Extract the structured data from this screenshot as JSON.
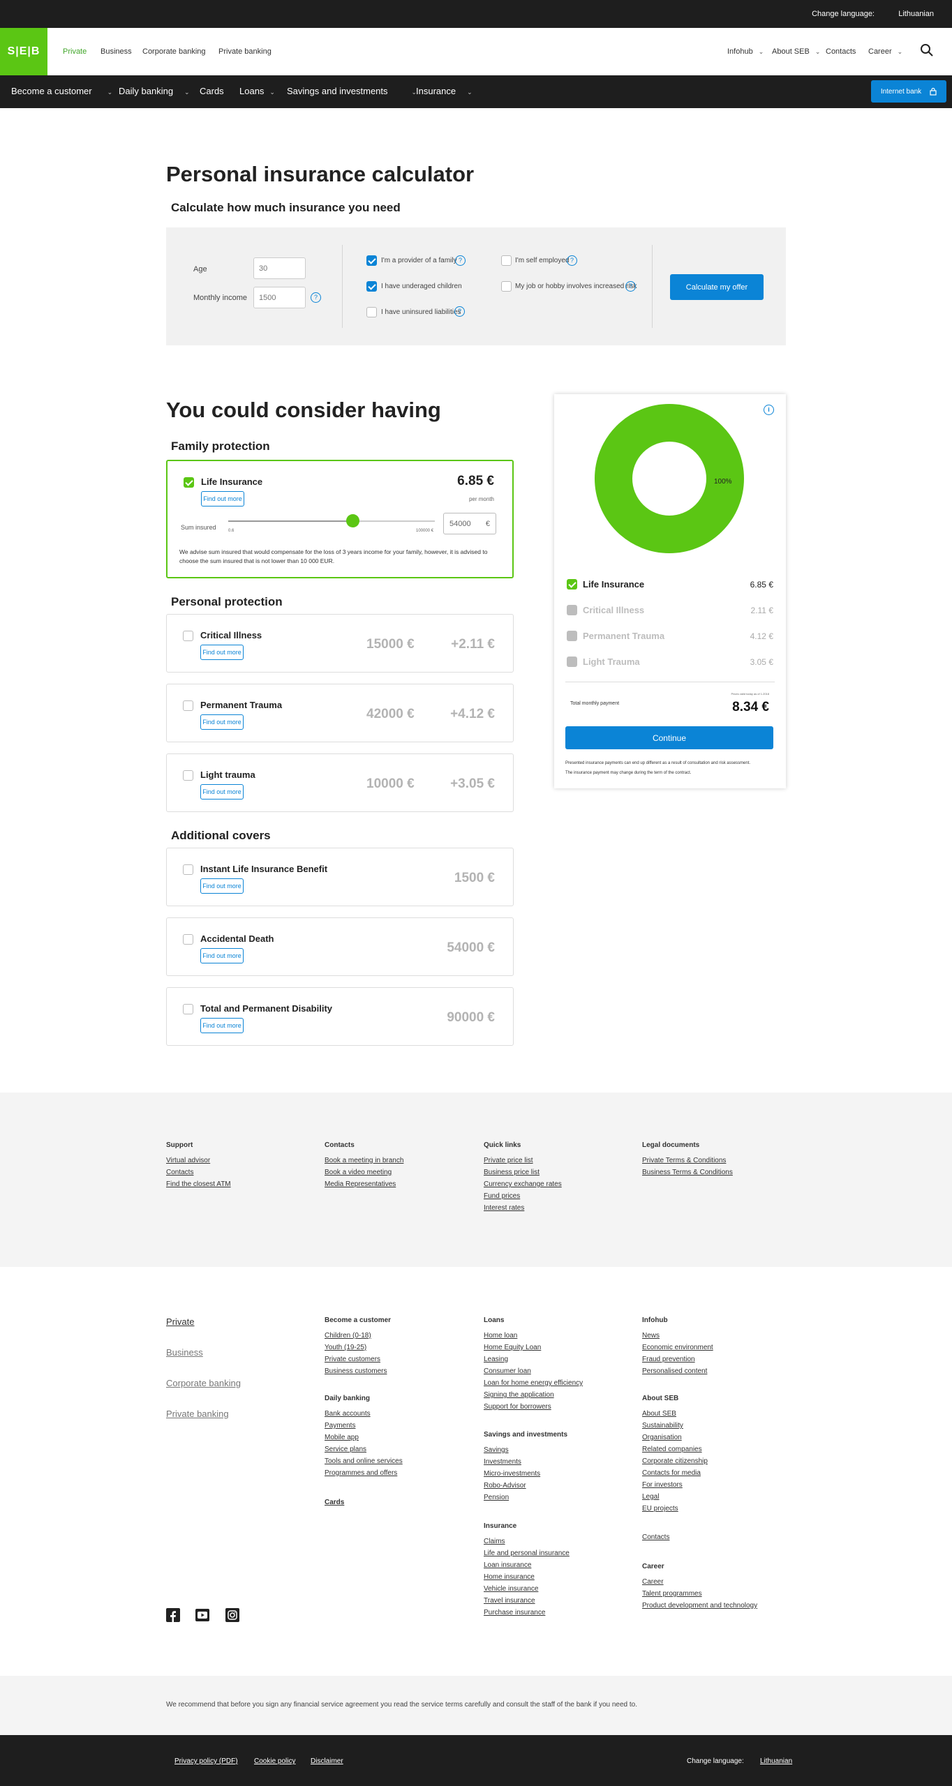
{
  "topbar": {
    "change_language_label": "Change language:",
    "language_link": "Lithuanian"
  },
  "header": {
    "logo": "S|E|B",
    "segments": [
      "Private",
      "Business",
      "Corporate banking",
      "Private banking"
    ],
    "right_nav": [
      "Infohub",
      "About SEB",
      "Contacts",
      "Career"
    ]
  },
  "main_nav": {
    "items": [
      "Become a customer",
      "Daily banking",
      "Cards",
      "Loans",
      "Savings and investments",
      "Insurance"
    ],
    "internet_bank": "Internet bank"
  },
  "calculator": {
    "title": "Personal insurance calculator",
    "subtitle": "Calculate how much insurance you need",
    "age_label": "Age",
    "age_value": "30",
    "income_label": "Monthly income",
    "income_value": "1500",
    "options": [
      {
        "label": "I'm a provider of a family",
        "checked": true
      },
      {
        "label": "I have underaged children",
        "checked": true
      },
      {
        "label": "I have uninsured liabilities",
        "checked": false
      },
      {
        "label": "I'm self employed",
        "checked": false
      },
      {
        "label": "My job or hobby involves increased risk",
        "checked": false
      }
    ],
    "button": "Calculate my offer"
  },
  "results": {
    "title": "You could consider having",
    "find_out_more": "Find out more",
    "family_protection": {
      "heading": "Family protection",
      "life_insurance": {
        "name": "Life Insurance",
        "price": "6.85 €",
        "per": "per month",
        "sum_label": "Sum insured",
        "slider_min": "0.6",
        "slider_max": "100000 €",
        "slider_level": 0.6,
        "sum_value": "54000",
        "currency": "€",
        "advice": "We advise sum insured that would compensate for the loss of 3 years income for your family, however, it is advised to choose the sum insured that is not lower than 10 000 EUR."
      }
    },
    "personal_protection": {
      "heading": "Personal protection",
      "items": [
        {
          "name": "Critical Illness",
          "amount": "15000 €",
          "price": "+2.11 €"
        },
        {
          "name": "Permanent Trauma",
          "amount": "42000 €",
          "price": "+4.12 €"
        },
        {
          "name": "Light trauma",
          "amount": "10000 €",
          "price": "+3.05 €"
        }
      ]
    },
    "additional_covers": {
      "heading": "Additional covers",
      "items": [
        {
          "name": "Instant Life Insurance Benefit",
          "amount": "1500 €"
        },
        {
          "name": "Accidental Death",
          "amount": "54000 €"
        },
        {
          "name": "Total and Permanent Disability",
          "amount": "90000 €"
        }
      ]
    }
  },
  "summary": {
    "donut_percent": "100%",
    "donut_color": "#5bc614",
    "rows": [
      {
        "name": "Life Insurance",
        "value": "6.85 €",
        "checked": true
      },
      {
        "name": "Critical Illness",
        "value": "2.11 €",
        "checked": false
      },
      {
        "name": "Permanent Trauma",
        "value": "4.12 €",
        "checked": false
      },
      {
        "name": "Light Trauma",
        "value": "3.05 €",
        "checked": false
      }
    ],
    "fine_print": "Prices valid today as of 1.2018",
    "total_label": "Total monthly payment",
    "total_value": "8.34 €",
    "continue": "Continue",
    "note1": "Presented insurance payments can end up different as a result of consultation and risk assessment.",
    "note2": "The insurance payment may change during the term of the contract."
  },
  "footer_top": {
    "columns": [
      {
        "heading": "Support",
        "links": [
          "Virtual advisor",
          "Contacts",
          "Find the closest ATM"
        ]
      },
      {
        "heading": "Contacts",
        "links": [
          "Book a meeting in branch",
          "Book a video meeting",
          "Media Representatives"
        ]
      },
      {
        "heading": "Quick links",
        "links": [
          "Private price list",
          "Business price list",
          "Currency exchange rates",
          "Fund prices",
          "Interest rates"
        ]
      },
      {
        "heading": "Legal documents",
        "links": [
          "Private Terms & Conditions",
          "Business Terms & Conditions"
        ]
      }
    ]
  },
  "footer_main": {
    "segments": [
      "Private",
      "Business",
      "Corporate banking",
      "Private banking"
    ],
    "become_customer": {
      "heading": "Become a customer",
      "links": [
        "Children (0-18)",
        "Youth (19-25)",
        "Private customers",
        "Business customers"
      ]
    },
    "daily_banking": {
      "heading": "Daily banking",
      "links": [
        "Bank accounts",
        "Payments",
        "Mobile app",
        "Service plans",
        "Tools and online services",
        "Programmes and offers"
      ]
    },
    "cards": {
      "heading": "Cards"
    },
    "loans": {
      "heading": "Loans",
      "links": [
        "Home loan",
        "Home Equity Loan",
        "Leasing",
        "Consumer loan",
        "Loan for home energy efficiency",
        "Signing the application",
        "Support for borrowers"
      ]
    },
    "savings": {
      "heading": "Savings and investments",
      "links": [
        "Savings",
        "Investments",
        "Micro-investments",
        "Robo-Advisor",
        "Pension"
      ]
    },
    "insurance": {
      "heading": "Insurance",
      "links": [
        "Claims",
        "Life and personal insurance",
        "Loan insurance",
        "Home insurance",
        "Vehicle insurance",
        "Travel insurance",
        "Purchase insurance"
      ]
    },
    "infohub": {
      "heading": "Infohub",
      "links": [
        "News",
        "Economic environment",
        "Fraud prevention",
        "Personalised content"
      ]
    },
    "about": {
      "heading": "About SEB",
      "links": [
        "About SEB",
        "Sustainability",
        "Organisation",
        "Related companies",
        "Corporate citizenship",
        "Contacts for media",
        "For investors",
        "Legal",
        "EU projects"
      ]
    },
    "contacts_link": "Contacts",
    "career": {
      "heading": "Career",
      "links": [
        "Career",
        "Talent programmes",
        "Product development and technology"
      ]
    }
  },
  "disclaimer": "We recommend that before you sign any financial service agreement you read the service terms carefully and consult the staff of the bank if you need to.",
  "bottom_bar": {
    "links": [
      "Privacy policy (PDF)",
      "Cookie policy",
      "Disclaimer"
    ],
    "change_language_label": "Change language:",
    "language_link": "Lithuanian"
  }
}
